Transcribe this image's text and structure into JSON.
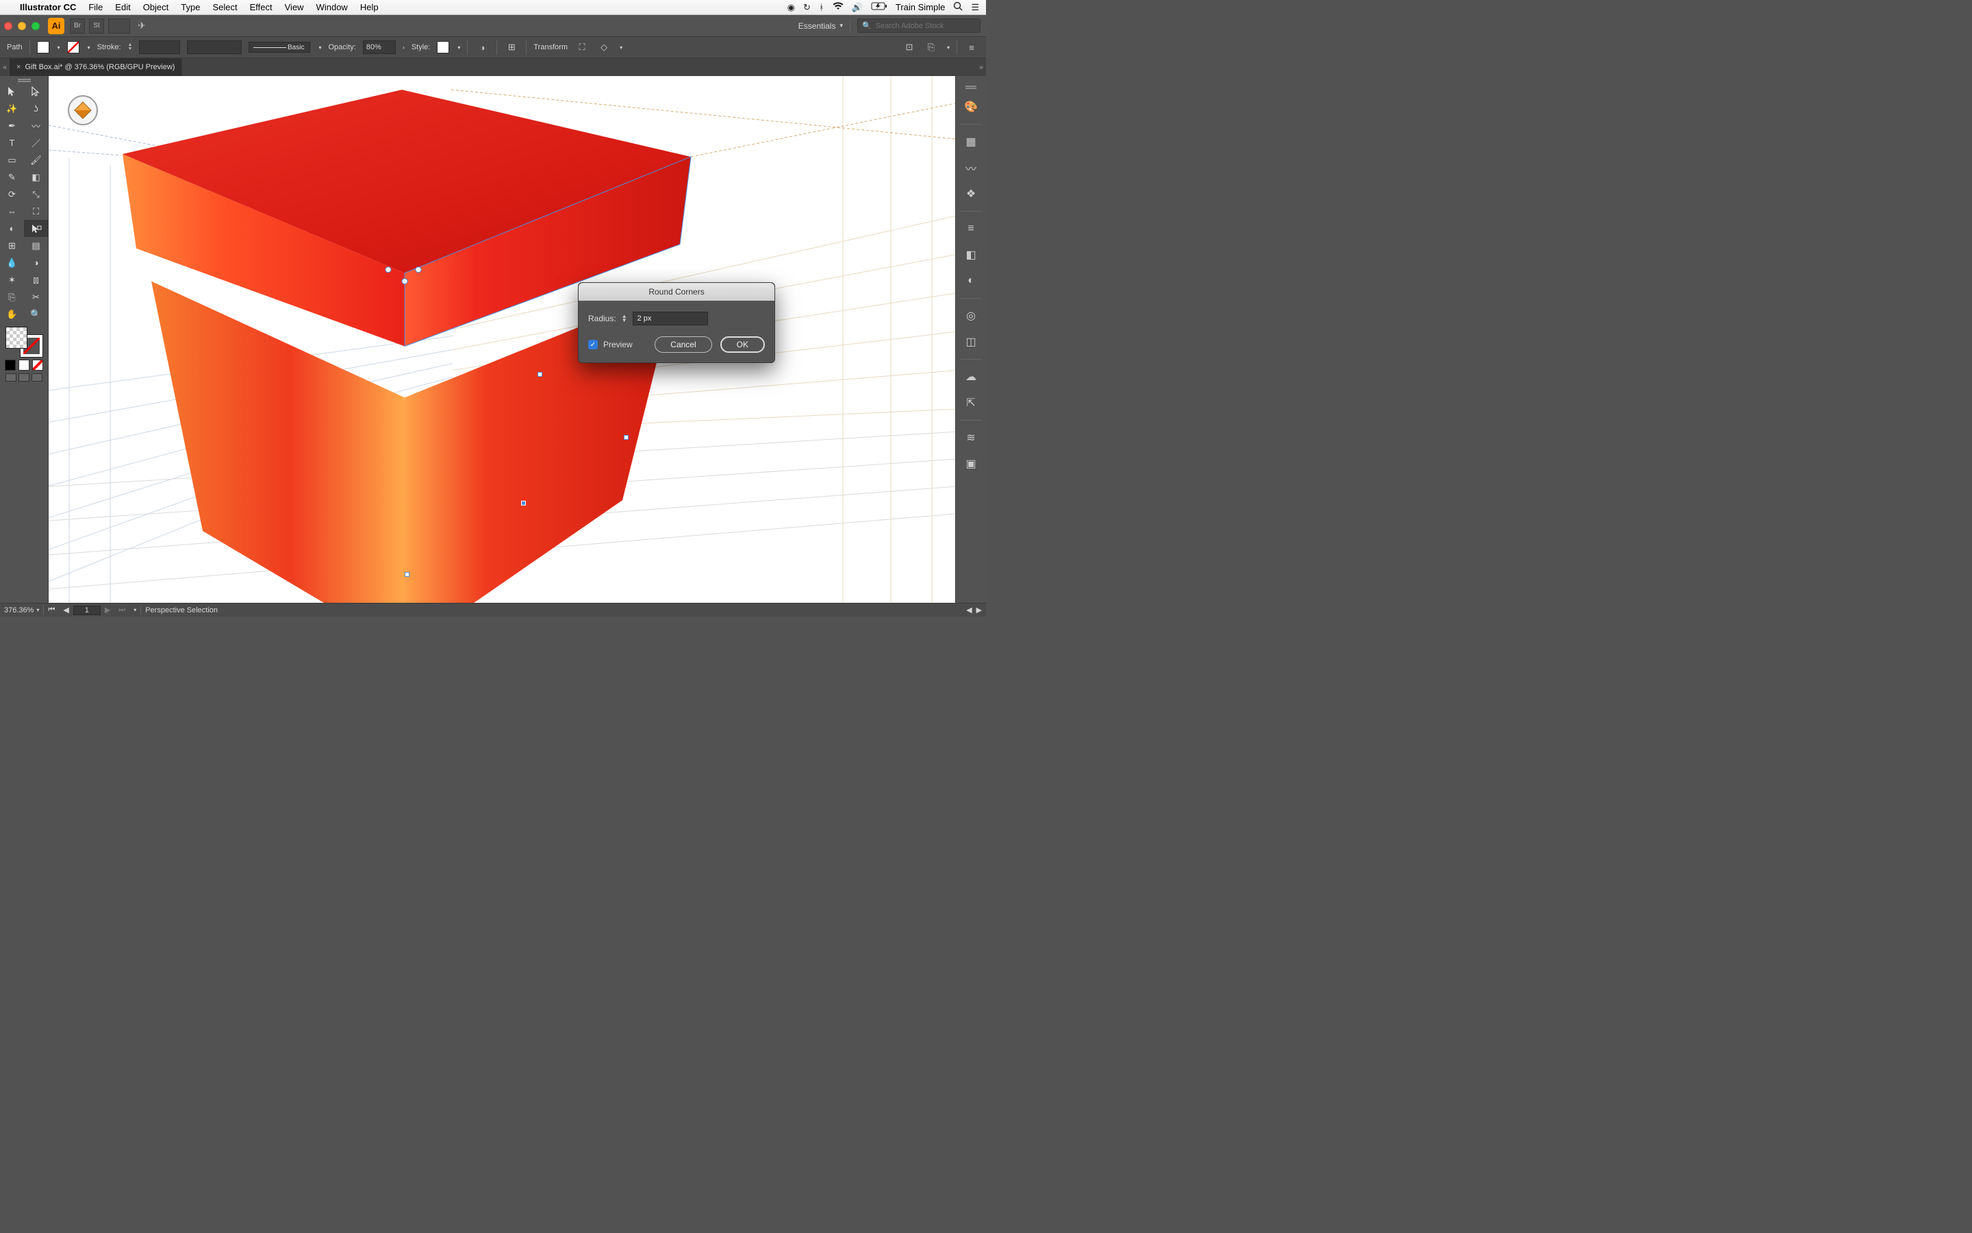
{
  "mac_menu": {
    "app_name": "Illustrator CC",
    "items": [
      "File",
      "Edit",
      "Object",
      "Type",
      "Select",
      "Effect",
      "View",
      "Window",
      "Help"
    ],
    "status_icons": [
      "cc-sync",
      "timeMachine",
      "bluetooth",
      "wifi",
      "volume",
      "battery"
    ],
    "account": "Train Simple",
    "right_icons_trail": [
      "search",
      "listmenu"
    ]
  },
  "app_bar": {
    "doc_library_labels": [
      "Br",
      "St"
    ],
    "workspace_label": "Essentials",
    "stock_placeholder": "Search Adobe Stock"
  },
  "control_bar": {
    "left_label": "Path",
    "stroke_label": "Stroke:",
    "brush_label": "Basic",
    "opacity_label": "Opacity:",
    "opacity_value": "80%",
    "style_label": "Style:",
    "transform_label": "Transform"
  },
  "tab": {
    "title": "Gift Box.ai* @ 376.36% (RGB/GPU Preview)"
  },
  "status": {
    "zoom": "376.36%",
    "artboard_idx": "1",
    "tool": "Perspective Selection"
  },
  "dialog": {
    "title": "Round Corners",
    "radius_label": "Radius:",
    "radius_value": "2 px",
    "preview_label": "Preview",
    "cancel": "Cancel",
    "ok": "OK",
    "preview_checked": true
  },
  "tools": [
    "selection",
    "direct-selection",
    "magic-wand",
    "lasso",
    "pen",
    "curvature",
    "type",
    "line",
    "rectangle",
    "paintbrush",
    "pencil",
    "eraser",
    "rotate",
    "scale",
    "width",
    "free-transform",
    "shapebuilder",
    "perspective-grid",
    "mesh",
    "gradient",
    "eyedropper",
    "blend",
    "symbol-sprayer",
    "column-graph",
    "artboard",
    "slice",
    "hand",
    "zoom"
  ],
  "dock": [
    "color",
    "swatches",
    "brushes",
    "symbols",
    "stroke",
    "gradient",
    "transparency",
    "appearance",
    "graphic-styles",
    "cc-libraries",
    "export",
    "layers",
    "artboards"
  ]
}
